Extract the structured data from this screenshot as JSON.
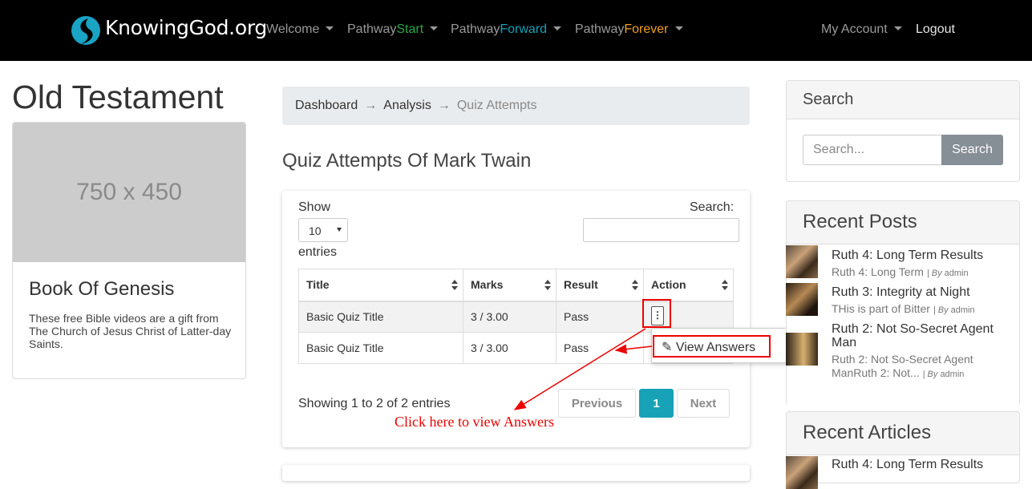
{
  "nav": {
    "logo": "KnowingGod.org",
    "items": [
      {
        "prefix": "Welcome",
        "suffix": "",
        "suffix_color": ""
      },
      {
        "prefix": "Pathway",
        "suffix": "Start",
        "suffix_color": "#28a745"
      },
      {
        "prefix": "Pathway",
        "suffix": "Forward",
        "suffix_color": "#17a2b8"
      },
      {
        "prefix": "Pathway",
        "suffix": "Forever",
        "suffix_color": "#f0a020"
      }
    ],
    "account": "My Account",
    "logout": "Logout"
  },
  "left": {
    "page_title": "Old Testament",
    "placeholder": "750 x 450",
    "card_title": "Book Of Genesis",
    "card_text": "These free Bible videos are a gift from The Church of Jesus Christ of Latter-day Saints."
  },
  "breadcrumb": {
    "items": [
      "Dashboard",
      "Analysis"
    ],
    "active": "Quiz Attempts",
    "separator": "→"
  },
  "main": {
    "title": "Quiz Attempts Of Mark Twain",
    "show_label": "Show",
    "entries_value": "10",
    "entries_label": "entries",
    "search_label": "Search:",
    "columns": [
      "Title",
      "Marks",
      "Result",
      "Action"
    ],
    "rows": [
      {
        "title": "Basic Quiz Title",
        "marks": "3 / 3.00",
        "result": "Pass"
      },
      {
        "title": "Basic Quiz Title",
        "marks": "3 / 3.00",
        "result": "Pass"
      }
    ],
    "action_icon": "kebab-menu-icon",
    "dropdown_item": "View Answers",
    "info": "Showing 1 to 2 of 2 entries",
    "pagination": {
      "previous": "Previous",
      "page": "1",
      "next": "Next"
    },
    "annotation": "Click here to view Answers"
  },
  "sidebar": {
    "search_title": "Search",
    "search_placeholder": "Search...",
    "search_button": "Search",
    "recent_posts_title": "Recent Posts",
    "posts": [
      {
        "title": "Ruth 4: Long Term Results",
        "excerpt": "Ruth 4: Long Term",
        "by": "By",
        "author": "admin"
      },
      {
        "title": "Ruth 3: Integrity at Night",
        "excerpt": "THis is part of Bitter",
        "by": "By",
        "author": "admin"
      },
      {
        "title_line1": "Ruth 2: Not So-Secret Agent",
        "title_line2": "Man",
        "excerpt_line1": "Ruth 2: Not So-Secret Agent",
        "excerpt_line2": "ManRuth 2: Not...",
        "by": "By",
        "author": "admin"
      }
    ],
    "recent_articles_title": "Recent Articles",
    "articles": [
      {
        "title": "Ruth 4: Long Term Results"
      }
    ]
  },
  "colors": {
    "accent": "#17a2b8",
    "annotation": "#e00000",
    "navbar": "#000000"
  }
}
